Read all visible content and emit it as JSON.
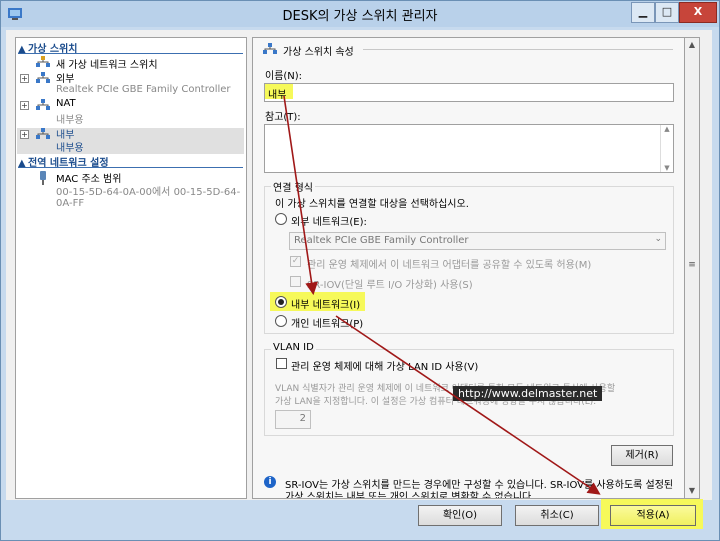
{
  "window": {
    "title": "DESK의 가상 스위치 관리자",
    "min": "▁",
    "max": "□",
    "close": "X"
  },
  "left": {
    "section_switches": "가상 스위치",
    "new_switch": "새 가상 네트워크 스위치",
    "external": {
      "name": "외부",
      "desc": "Realtek PCIe GBE Family Controller"
    },
    "nat": {
      "name": "NAT",
      "desc": "내부용"
    },
    "internal": {
      "name": "내부",
      "desc": "내부용"
    },
    "section_global": "전역 네트워크 설정",
    "mac": {
      "name": "MAC 주소 범위",
      "desc": "00-15-5D-64-0A-00에서 00-15-5D-64-0A-FF"
    }
  },
  "right": {
    "header": "가상 스위치 속성",
    "name_label": "이름(N):",
    "name_value": "내부",
    "notes_label": "참고(T):",
    "conn_type": "연결 형식",
    "conn_desc": "이 가상 스위치를 연결할 대상을 선택하십시오.",
    "external_radio": "외부 네트워크(E):",
    "adapter": "Realtek PCIe GBE Family Controller",
    "allow_mgmt": "관리 운영 체제에서 이 네트워크 어댑터를 공유할 수 있도록 허용(M)",
    "sriov": "SR-IOV(단일 루트 I/O 가상화) 사용(S)",
    "internal_radio": "내부 네트워크(I)",
    "private_radio": "개인 네트워크(P)",
    "vlan_title": "VLAN ID",
    "vlan_check": "관리 운영 체제에 대해 가상 LAN ID 사용(V)",
    "vlan_desc1": "VLAN 식별자가 관리 운영 체제에 이 네트워크 어댑터를 통한 모든 네트워크 통신에 사용할",
    "vlan_desc2": "가상 LAN을 지정합니다. 이 설정은 가상 컴퓨터 네트워킹에 영향을 주지 않습니다(L).",
    "vlan_value": "2",
    "remove": "제거(R)",
    "info1": "SR-IOV는 가상 스위치를 만드는 경우에만 구성할 수 있습니다. SR-IOV를 사용하도록 설정된",
    "info2": "가상 스위치는 내부 또는 개인 스위치로 변환할 수 없습니다."
  },
  "watermark": "http://www.delmaster.net",
  "buttons": {
    "ok": "확인(O)",
    "cancel": "취소(C)",
    "apply": "적용(A)"
  },
  "colors": {
    "highlight": "#f6f95a",
    "arrow": "#a01818",
    "section": "#1a4b8c"
  }
}
